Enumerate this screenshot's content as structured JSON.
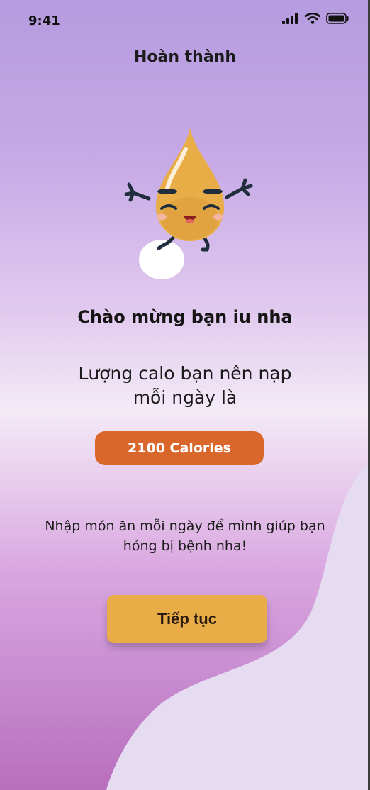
{
  "status_bar": {
    "time": "9:41",
    "signal_icon": "cellular-signal-icon",
    "wifi_icon": "wifi-icon",
    "battery_icon": "battery-icon"
  },
  "header": {
    "title": "Hoàn thành"
  },
  "mascot": {
    "icon": "oil-drop-mascot-icon"
  },
  "welcome": {
    "text": "Chào mừng bạn iu nha"
  },
  "calorie": {
    "line1": "Lượng calo bạn nên nạp",
    "line2": "mỗi ngày là",
    "value_label": "2100 Calories"
  },
  "note": {
    "line1": "Nhập món ăn mỗi ngày để mình giúp bạn",
    "line2": "hỏng bị bệnh nha!"
  },
  "actions": {
    "continue_label": "Tiếp tục"
  },
  "colors": {
    "accent_orange": "#d9672c",
    "button_yellow": "#e9ad48",
    "wave_light": "#e6dcf2"
  }
}
